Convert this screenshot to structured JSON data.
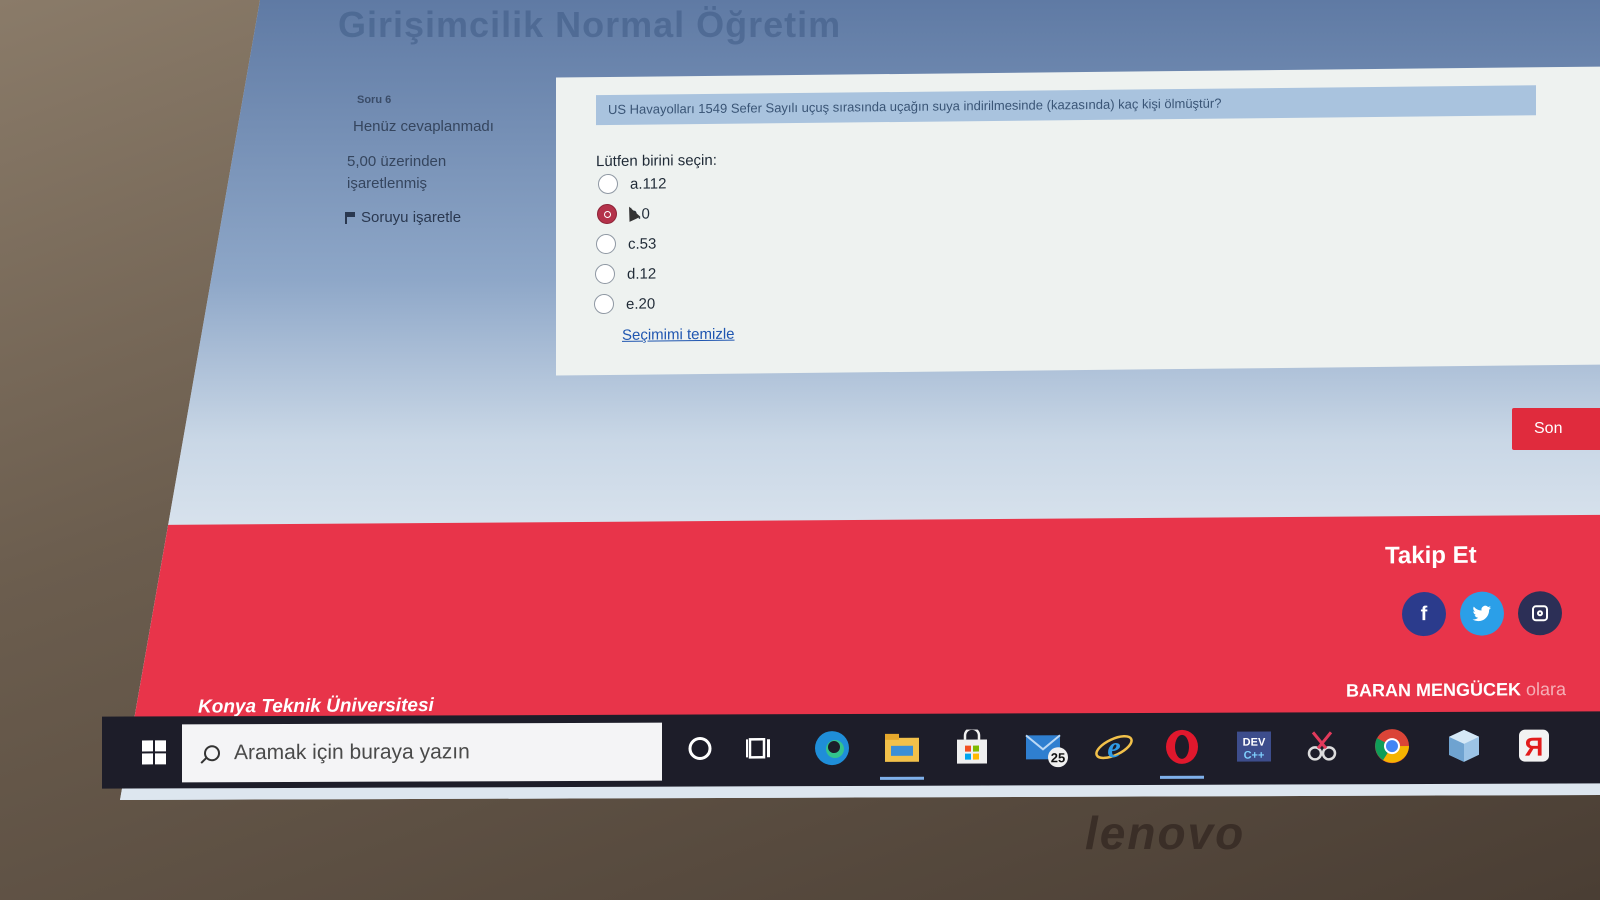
{
  "course_title": "Girişimcilik Normal Öğretim",
  "question_info": {
    "number_label": "Soru 6",
    "state": "Henüz cevaplanmadı",
    "mark_line1": "5,00 üzerinden",
    "mark_line2": "işaretlenmiş",
    "flag_label": "Soruyu işaretle"
  },
  "question": {
    "text": "US Havayolları 1549 Sefer Sayılı uçuş sırasında uçağın suya indirilmesinde (kazasında) kaç kişi ölmüştür?",
    "prompt": "Lütfen birini seçin:",
    "options": [
      {
        "label": "a.112",
        "selected": false
      },
      {
        "label": "b.0",
        "selected": true
      },
      {
        "label": "c.53",
        "selected": false
      },
      {
        "label": "d.12",
        "selected": false
      },
      {
        "label": "e.20",
        "selected": false
      }
    ],
    "clear_link": "Seçimimi temizle"
  },
  "finish_button": "Son",
  "footer": {
    "follow_title": "Takip Et",
    "social_icons": [
      "facebook-icon",
      "twitter-icon",
      "instagram-icon"
    ],
    "university": "Konya Teknik Üniversitesi",
    "author": "BARAN MENGÜCEK",
    "author_suffix": "olara"
  },
  "taskbar": {
    "search_placeholder": "Aramak için buraya yazın",
    "mail_badge": "25",
    "icons": [
      "cortana-icon",
      "task-view-icon",
      "edge-icon",
      "file-explorer-icon",
      "store-icon",
      "mail-icon",
      "internet-explorer-icon",
      "opera-icon",
      "dev-cpp-icon",
      "snip-icon",
      "chrome-icon",
      "box-icon",
      "yandex-icon"
    ]
  },
  "bezel_brand": "lenovo",
  "colors": {
    "footer_red": "#e8344a",
    "selected_radio": "#b4324a",
    "link_blue": "#1f56b0",
    "taskbar": "#1d1d29"
  }
}
